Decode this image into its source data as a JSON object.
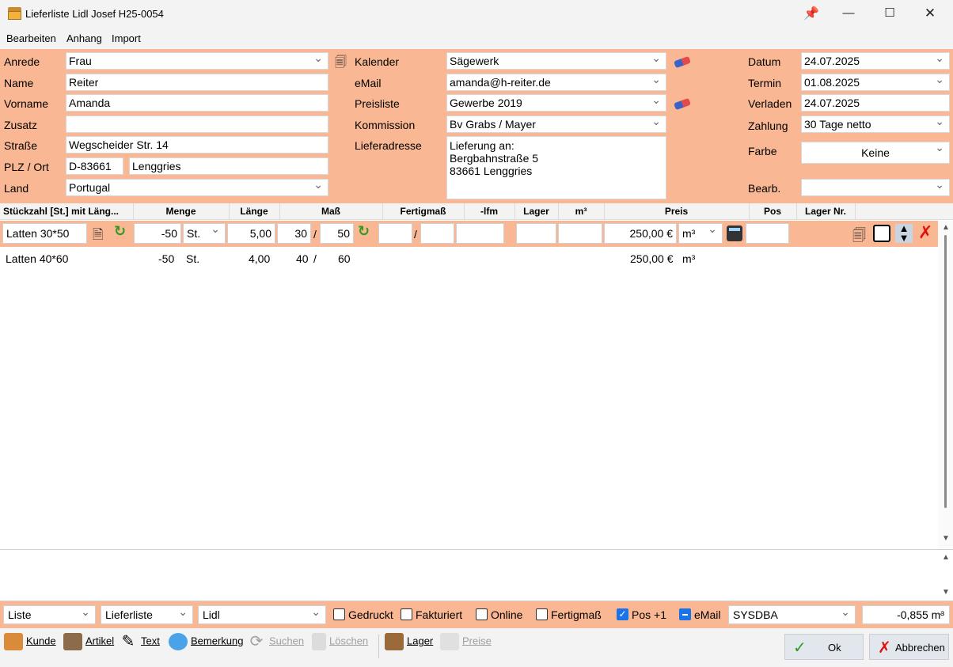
{
  "window": {
    "title": "Lieferliste Lidl Josef H25-0054",
    "minimize": "—",
    "maximize": "☐",
    "close": "✕"
  },
  "menu": [
    "Bearbeiten",
    "Anhang",
    "Import"
  ],
  "form": {
    "anrede": {
      "label": "Anrede",
      "value": "Frau"
    },
    "name": {
      "label": "Name",
      "value": "Reiter"
    },
    "vorname": {
      "label": "Vorname",
      "value": "Amanda"
    },
    "zusatz": {
      "label": "Zusatz",
      "value": ""
    },
    "strasse": {
      "label": "Straße",
      "value": "Wegscheider Str. 14"
    },
    "plzort": {
      "label": "PLZ / Ort",
      "plz": "D-83661",
      "ort": "Lenggries"
    },
    "land": {
      "label": "Land",
      "value": "Portugal"
    },
    "kalender": {
      "label": "Kalender",
      "value": "Sägewerk"
    },
    "email": {
      "label": "eMail",
      "value": "amanda@h-reiter.de"
    },
    "preisliste": {
      "label": "Preisliste",
      "value": "Gewerbe 2019"
    },
    "kommission": {
      "label": "Kommission",
      "value": "Bv Grabs / Mayer"
    },
    "lieferadresse": {
      "label": "Lieferadresse",
      "value": "Lieferung an:\nBergbahnstraße 5\n83661 Lenggries"
    },
    "datum": {
      "label": "Datum",
      "value": "24.07.2025"
    },
    "termin": {
      "label": "Termin",
      "value": "01.08.2025"
    },
    "verladen": {
      "label": "Verladen",
      "value": "24.07.2025"
    },
    "zahlung": {
      "label": "Zahlung",
      "value": "30 Tage netto"
    },
    "farbe": {
      "label": "Farbe",
      "value": "Keine"
    },
    "bearb": {
      "label": "Bearb.",
      "value": ""
    }
  },
  "grid": {
    "headers": [
      "Stückzahl [St.] mit Läng...",
      "Menge",
      "Länge",
      "Maß",
      "Fertigmaß",
      "-lfm",
      "Lager",
      "m³",
      "Preis",
      "Pos",
      "Lager Nr."
    ],
    "edit_row": {
      "artikel": "Latten 30*50",
      "menge": "-50",
      "einheit": "St.",
      "laenge": "5,00",
      "mass1": "30",
      "mass2": "50",
      "preis": "250,00 €",
      "preiseinheit": "m³"
    },
    "rows": [
      {
        "artikel": "Latten 40*60",
        "menge": "-50",
        "einheit": "St.",
        "laenge": "4,00",
        "mass1": "40",
        "sep": "/",
        "mass2": "60",
        "preis": "250,00 €",
        "preiseinheit": "m³"
      }
    ]
  },
  "bottom": {
    "liste": "Liste",
    "typ": "Lieferliste",
    "filiale": "Lidl",
    "checks": [
      {
        "label": "Gedruckt",
        "state": "off"
      },
      {
        "label": "Fakturiert",
        "state": "off"
      },
      {
        "label": "Online",
        "state": "off"
      },
      {
        "label": "Fertigmaß",
        "state": "off"
      },
      {
        "label": "Pos +1",
        "state": "on"
      },
      {
        "label": "eMail",
        "state": "indeterminate"
      }
    ],
    "user": "SYSDBA",
    "total": "-0,855 m³"
  },
  "toolbar": {
    "kunde": "Kunde",
    "artikel": "Artikel",
    "text": "Text",
    "bemerkung": "Bemerkung",
    "suchen": "Suchen",
    "loeschen": "Löschen",
    "lager": "Lager",
    "preise": "Preise",
    "ok": "Ok",
    "abbrechen": "Abbrechen"
  }
}
